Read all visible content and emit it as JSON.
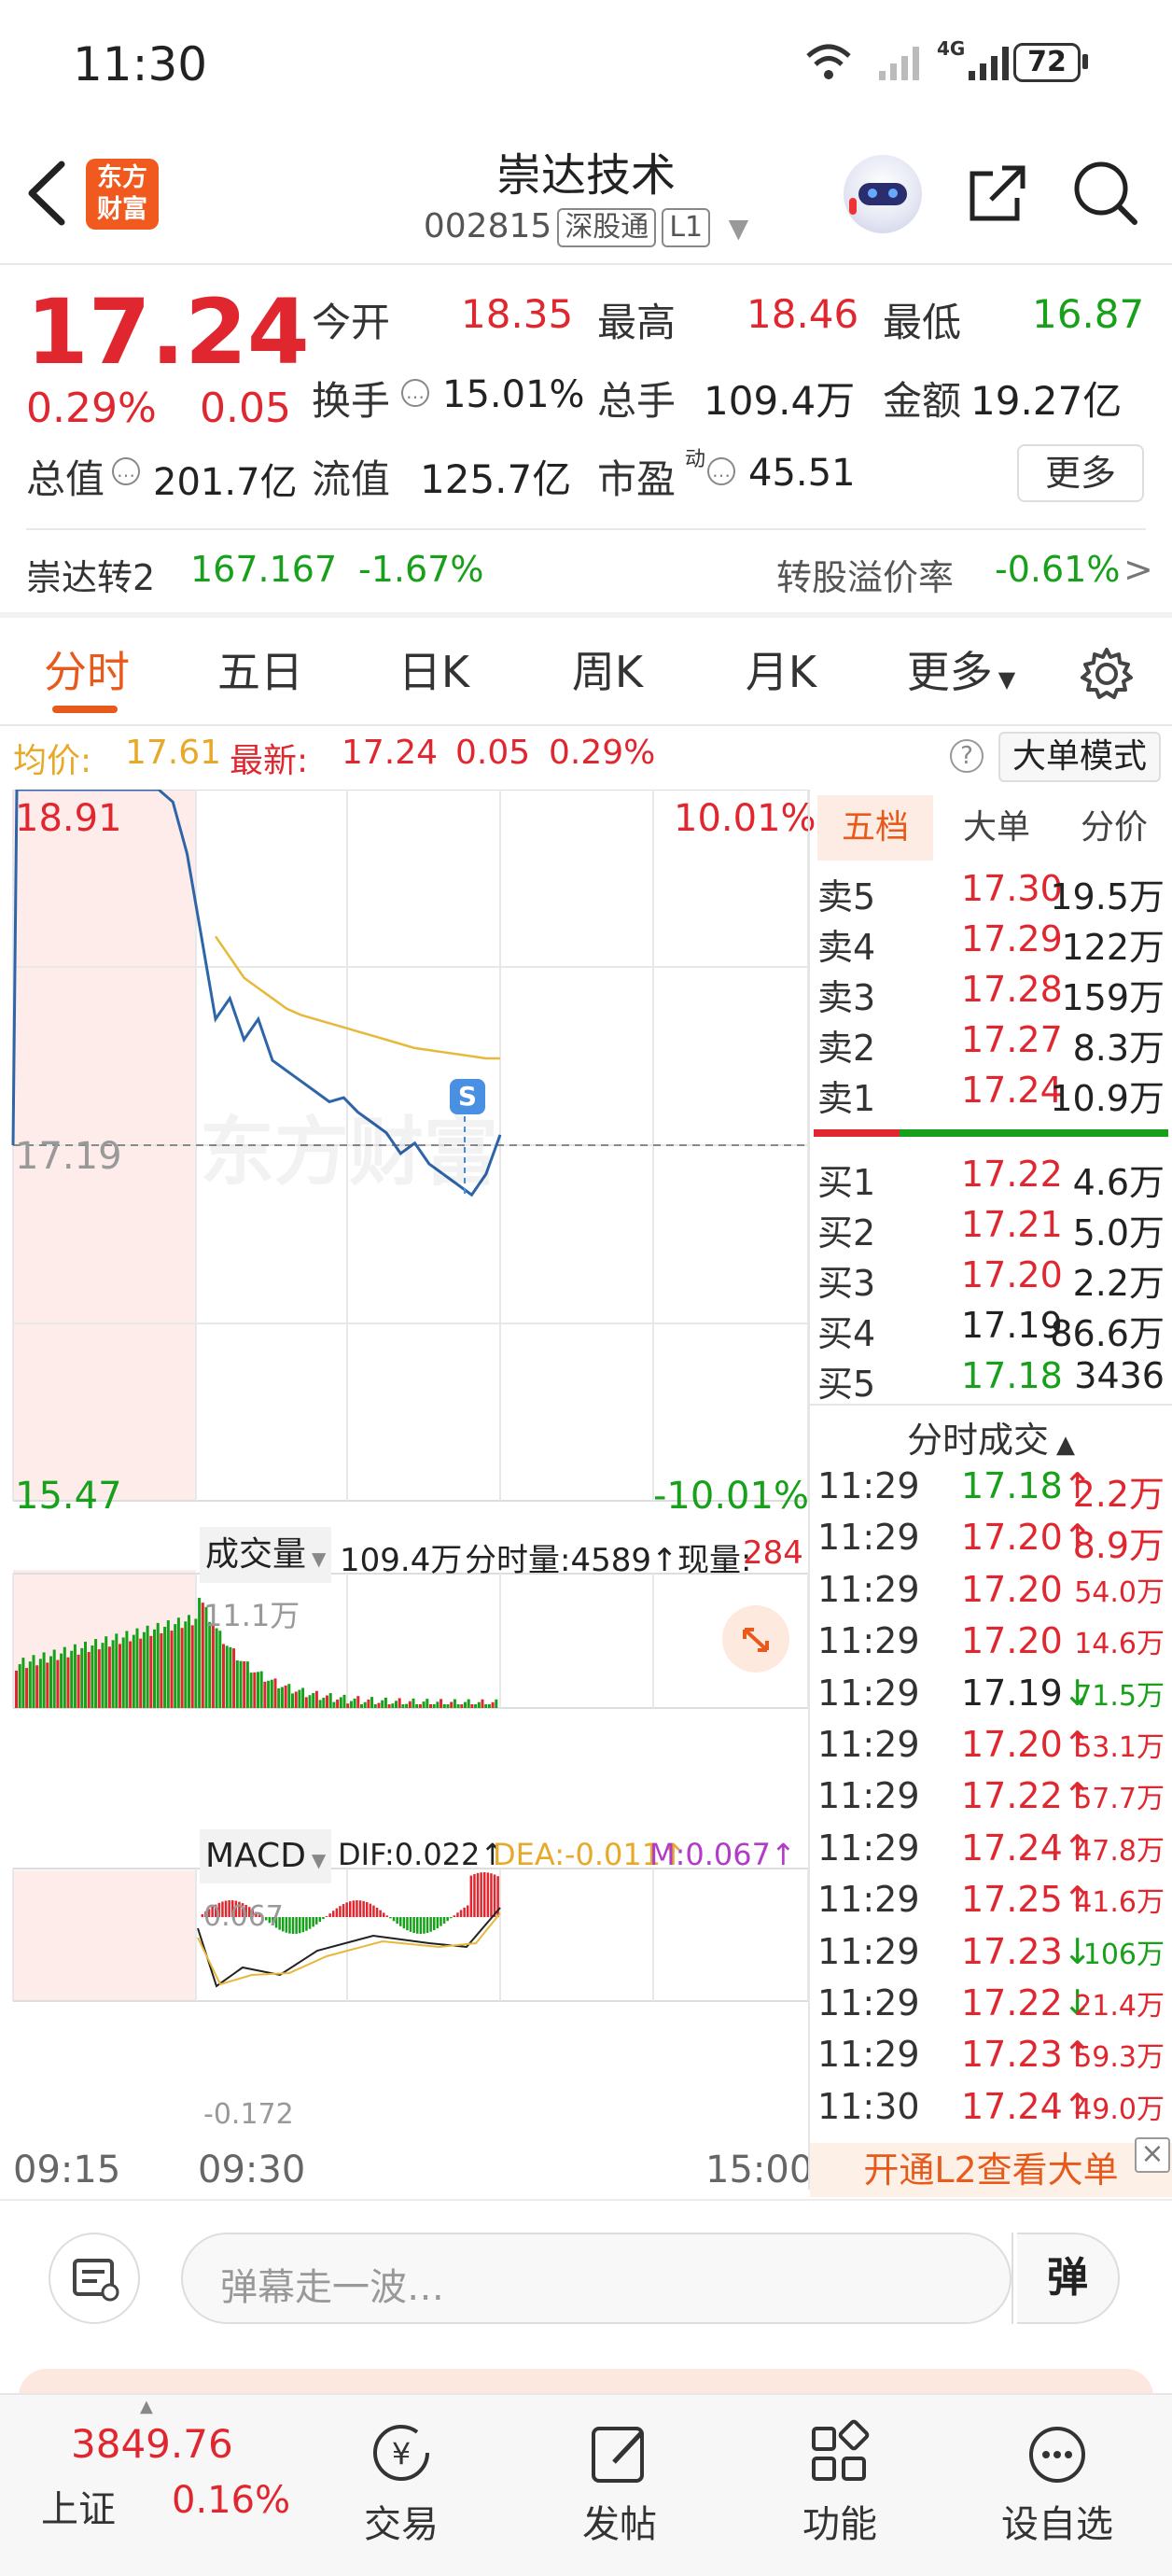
{
  "status": {
    "time": "11:30",
    "network": "4G",
    "battery": "72"
  },
  "header": {
    "title": "崇达技术",
    "code": "002815",
    "tag1": "深股通",
    "tag2": "L1",
    "logo_line1": "东方",
    "logo_line2": "财富"
  },
  "quote": {
    "price": "17.24",
    "change_pct": "0.29%",
    "change": "0.05",
    "open_label": "今开",
    "open": "18.35",
    "high_label": "最高",
    "high": "18.46",
    "low_label": "最低",
    "low": "16.87",
    "turnover_label": "换手",
    "turnover": "15.01%",
    "volume_label": "总手",
    "volume": "109.4万",
    "amount_label": "金额",
    "amount": "19.27亿",
    "mcap_label": "总值",
    "mcap": "201.7亿",
    "float_label": "流值",
    "float_cap": "125.7亿",
    "pe_label": "市盈",
    "pe_sup": "动",
    "pe": "45.51",
    "more_button": "更多"
  },
  "bond": {
    "name": "崇达转2",
    "price": "167.167",
    "pct": "-1.67%",
    "premium_label": "转股溢价率",
    "premium": "-0.61%",
    "arrow": ">"
  },
  "tabs": [
    "分时",
    "五日",
    "日K",
    "周K",
    "月K",
    "更多"
  ],
  "info_bar": {
    "avg_label": "均价:",
    "avg": "17.61",
    "latest_label": "最新:",
    "latest": "17.24",
    "chg": "0.05",
    "pct": "0.29%",
    "help": "?",
    "mode_button": "大单模式"
  },
  "chart": {
    "y_top": "18.91",
    "y_mid": "17.19",
    "y_bottom": "15.47",
    "pct_top": "10.01%",
    "pct_bottom": "-10.01%",
    "s_marker": "S",
    "watermark": "东方财富",
    "vol_label": "成交量",
    "vol_total": "109.4万",
    "vol_period": "分时量:4589↑",
    "vol_now_label": "现量:",
    "vol_now": "284",
    "vol_max": "11.1万",
    "macd_label": "MACD",
    "dif": "DIF:0.022↑",
    "dea": "DEA:-0.011↑",
    "m": "M:0.067↑",
    "macd_top": "0.067",
    "macd_bottom": "-0.172",
    "time_start": "09:15",
    "time_open": "09:30",
    "time_end": "15:00"
  },
  "chart_data": {
    "type": "line",
    "y_range": [
      15.47,
      18.91
    ],
    "pre_close": 17.19,
    "series": [
      {
        "name": "最新",
        "values": [
          17.19,
          18.91,
          18.91,
          18.85,
          18.6,
          18.2,
          17.8,
          17.9,
          17.7,
          17.8,
          17.6,
          17.55,
          17.5,
          17.45,
          17.4,
          17.42,
          17.35,
          17.3,
          17.25,
          17.15,
          17.2,
          17.1,
          17.05,
          17.0,
          16.95,
          17.05,
          17.24
        ]
      },
      {
        "name": "均价",
        "values": [
          null,
          null,
          null,
          null,
          null,
          null,
          18.2,
          18.1,
          18.0,
          17.95,
          17.9,
          17.85,
          17.82,
          17.8,
          17.78,
          17.76,
          17.74,
          17.72,
          17.7,
          17.68,
          17.66,
          17.65,
          17.64,
          17.63,
          17.62,
          17.61,
          17.61
        ]
      }
    ]
  },
  "orderbook": {
    "tabs": [
      "五档",
      "大单",
      "分价"
    ],
    "asks": [
      {
        "label": "卖5",
        "price": "17.30",
        "vol": "19.5万"
      },
      {
        "label": "卖4",
        "price": "17.29",
        "vol": "122万"
      },
      {
        "label": "卖3",
        "price": "17.28",
        "vol": "159万"
      },
      {
        "label": "卖2",
        "price": "17.27",
        "vol": "8.3万"
      },
      {
        "label": "卖1",
        "price": "17.24",
        "vol": "10.9万"
      }
    ],
    "bids": [
      {
        "label": "买1",
        "price": "17.22",
        "vol": "4.6万"
      },
      {
        "label": "买2",
        "price": "17.21",
        "vol": "5.0万"
      },
      {
        "label": "买3",
        "price": "17.20",
        "vol": "2.2万"
      },
      {
        "label": "买4",
        "price": "17.19",
        "vol": "86.6万"
      },
      {
        "label": "买5",
        "price": "17.18",
        "vol": "3436"
      }
    ],
    "ticks_title": "分时成交",
    "ticks": [
      {
        "time": "11:29",
        "price": "17.18",
        "arrow": "↑",
        "vol": "2.2万",
        "pc": "green",
        "vc": "red"
      },
      {
        "time": "11:29",
        "price": "17.20",
        "arrow": "↑",
        "vol": "8.9万",
        "pc": "red",
        "vc": "red"
      },
      {
        "time": "11:29",
        "price": "17.20",
        "arrow": "",
        "vol": "54.0万",
        "pc": "red",
        "vc": "red"
      },
      {
        "time": "11:29",
        "price": "17.20",
        "arrow": "",
        "vol": "14.6万",
        "pc": "red",
        "vc": "red"
      },
      {
        "time": "11:29",
        "price": "17.19",
        "arrow": "↓",
        "vol": "71.5万",
        "pc": "dark",
        "vc": "green"
      },
      {
        "time": "11:29",
        "price": "17.20",
        "arrow": "↑",
        "vol": "53.1万",
        "pc": "red",
        "vc": "red"
      },
      {
        "time": "11:29",
        "price": "17.22",
        "arrow": "↑",
        "vol": "57.7万",
        "pc": "red",
        "vc": "red"
      },
      {
        "time": "11:29",
        "price": "17.24",
        "arrow": "↑",
        "vol": "47.8万",
        "pc": "red",
        "vc": "red"
      },
      {
        "time": "11:29",
        "price": "17.25",
        "arrow": "↑",
        "vol": "41.6万",
        "pc": "red",
        "vc": "red"
      },
      {
        "time": "11:29",
        "price": "17.23",
        "arrow": "↓",
        "vol": "106万",
        "pc": "red",
        "vc": "green"
      },
      {
        "time": "11:29",
        "price": "17.22",
        "arrow": "↓",
        "vol": "21.4万",
        "pc": "red",
        "vc": "red"
      },
      {
        "time": "11:29",
        "price": "17.23",
        "arrow": "↑",
        "vol": "59.3万",
        "pc": "red",
        "vc": "red"
      },
      {
        "time": "11:30",
        "price": "17.24",
        "arrow": "↑",
        "vol": "49.0万",
        "pc": "red",
        "vc": "red"
      }
    ],
    "l2_banner": "开通L2查看大单",
    "close": "×"
  },
  "comment": {
    "placeholder": "弹幕走一波…",
    "danmu_button": "弹"
  },
  "bottom_nav": {
    "index_value": "3849.76",
    "index_name": "上证",
    "index_pct": "0.16%",
    "items": [
      "交易",
      "发帖",
      "功能",
      "设自选"
    ]
  },
  "colors": {
    "up": "#e0262e",
    "down": "#17a01a",
    "accent": "#e85a1b",
    "price_line": "#2e65a8",
    "avg_line": "#e7b83a"
  }
}
